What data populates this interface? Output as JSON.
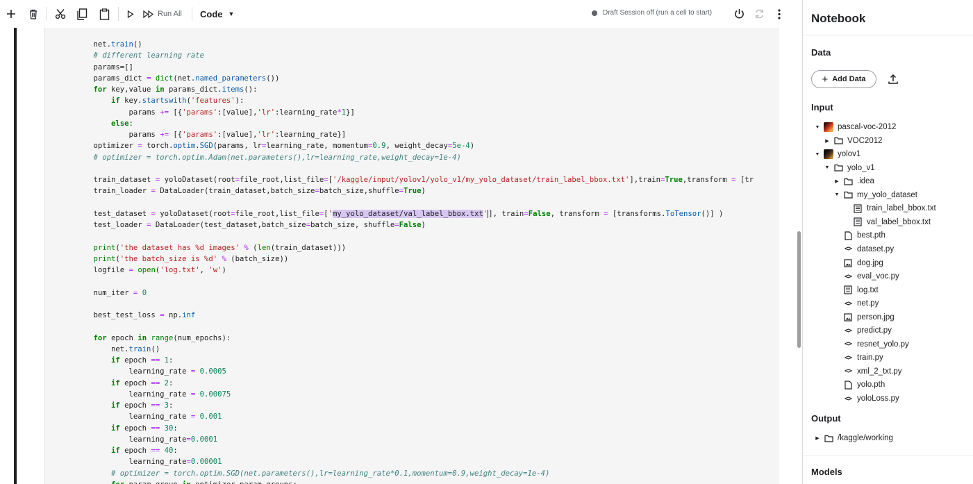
{
  "toolbar": {
    "run_all_label": "Run All",
    "cell_type": "Code",
    "session_status": "Draft Session off (run a cell to start)"
  },
  "code_lines": [
    [
      [
        "",
        "    net."
      ],
      [
        "f",
        "train"
      ],
      [
        "",
        "()"
      ]
    ],
    [
      [
        "c",
        "    # different learning rate"
      ]
    ],
    [
      [
        "",
        "    params=[]"
      ]
    ],
    [
      [
        "",
        "    params_dict "
      ],
      [
        "o",
        "="
      ],
      [
        "",
        ""
      ],
      [
        "b",
        " dict"
      ],
      [
        "",
        "(net."
      ],
      [
        "f",
        "named_parameters"
      ],
      [
        "",
        "())"
      ]
    ],
    [
      [
        "k",
        "    for"
      ],
      [
        "",
        " key,value "
      ],
      [
        "k",
        "in"
      ],
      [
        "",
        " params_dict."
      ],
      [
        "f",
        "items"
      ],
      [
        "",
        "():"
      ]
    ],
    [
      [
        "k",
        "        if"
      ],
      [
        "",
        " key."
      ],
      [
        "f",
        "startswith"
      ],
      [
        "",
        "("
      ],
      [
        "s",
        "'features'"
      ],
      [
        "",
        "):"
      ]
    ],
    [
      [
        "",
        "            params "
      ],
      [
        "o",
        "+="
      ],
      [
        "",
        " [{"
      ],
      [
        "s",
        "'params'"
      ],
      [
        "",
        ":[value],"
      ],
      [
        "s",
        "'lr'"
      ],
      [
        "",
        ":learning_rate"
      ],
      [
        "o",
        "*"
      ],
      [
        "n",
        "1"
      ],
      [
        "",
        "}]"
      ]
    ],
    [
      [
        "k",
        "        else"
      ],
      [
        "",
        ":"
      ]
    ],
    [
      [
        "",
        "            params "
      ],
      [
        "o",
        "+="
      ],
      [
        "",
        " [{"
      ],
      [
        "s",
        "'params'"
      ],
      [
        "",
        ":[value],"
      ],
      [
        "s",
        "'lr'"
      ],
      [
        "",
        ":learning_rate}]"
      ]
    ],
    [
      [
        "",
        "    optimizer "
      ],
      [
        "o",
        "="
      ],
      [
        "",
        " torch."
      ],
      [
        "f",
        "optim"
      ],
      [
        "",
        "."
      ],
      [
        "f",
        "SGD"
      ],
      [
        "",
        "(params, lr"
      ],
      [
        "o",
        "="
      ],
      [
        "",
        "learning_rate, momentum"
      ],
      [
        "o",
        "="
      ],
      [
        "n",
        "0.9"
      ],
      [
        "",
        ", weight_decay"
      ],
      [
        "o",
        "="
      ],
      [
        "n",
        "5e-4"
      ],
      [
        "",
        ")"
      ]
    ],
    [
      [
        "c",
        "    # optimizer = torch.optim.Adam(net.parameters(),lr=learning_rate,weight_decay=1e-4)"
      ]
    ],
    [
      [
        "",
        ""
      ]
    ],
    [
      [
        "",
        "    train_dataset "
      ],
      [
        "o",
        "="
      ],
      [
        "",
        " yoloDataset(root"
      ],
      [
        "o",
        "="
      ],
      [
        "",
        "file_root,list_file"
      ],
      [
        "o",
        "="
      ],
      [
        "",
        "["
      ],
      [
        "s",
        "'/kaggle/input/yolov1/yolo_v1/my_yolo_dataset/train_label_bbox.txt'"
      ],
      [
        "",
        "],train"
      ],
      [
        "o",
        "="
      ],
      [
        "k",
        "True"
      ],
      [
        "",
        ",transform "
      ],
      [
        "o",
        "="
      ],
      [
        "",
        " [tr"
      ]
    ],
    [
      [
        "",
        "    train_loader "
      ],
      [
        "o",
        "="
      ],
      [
        "",
        " DataLoader(train_dataset,batch_size"
      ],
      [
        "o",
        "="
      ],
      [
        "",
        "batch_size,shuffle"
      ],
      [
        "o",
        "="
      ],
      [
        "k",
        "True"
      ],
      [
        "",
        ")"
      ]
    ],
    [
      [
        "",
        ""
      ]
    ],
    [
      [
        "",
        "    test_dataset "
      ],
      [
        "o",
        "="
      ],
      [
        "",
        " yoloDataset(root"
      ],
      [
        "o",
        "="
      ],
      [
        "",
        "file_root,list_file"
      ],
      [
        "o",
        "="
      ],
      [
        "",
        "["
      ],
      [
        "s",
        "'"
      ],
      [
        "hl",
        "my_yolo_dataset/val_label_bbox.txt"
      ],
      [
        "s",
        "'"
      ],
      [
        "",
        ""
      ],
      [
        "cur",
        ""
      ],
      [
        "",
        ""
      ],
      [
        "",
        "], train"
      ],
      [
        "o",
        "="
      ],
      [
        "k",
        "False"
      ],
      [
        "",
        ", transform "
      ],
      [
        "o",
        "="
      ],
      [
        "",
        " [transforms."
      ],
      [
        "f",
        "ToTensor"
      ],
      [
        "",
        "()] )"
      ]
    ],
    [
      [
        "",
        "    test_loader "
      ],
      [
        "o",
        "="
      ],
      [
        "",
        " DataLoader(test_dataset,batch_size"
      ],
      [
        "o",
        "="
      ],
      [
        "",
        "batch_size, shuffle"
      ],
      [
        "o",
        "="
      ],
      [
        "k",
        "False"
      ],
      [
        "",
        ")"
      ]
    ],
    [
      [
        "",
        ""
      ]
    ],
    [
      [
        "b",
        "    print"
      ],
      [
        "",
        "("
      ],
      [
        "s",
        "'the dataset has %d images'"
      ],
      [
        "",
        " "
      ],
      [
        "o",
        "%"
      ],
      [
        "",
        " ("
      ],
      [
        "b",
        "len"
      ],
      [
        "",
        "(train_dataset)))"
      ]
    ],
    [
      [
        "b",
        "    print"
      ],
      [
        "",
        "("
      ],
      [
        "s",
        "'the batch_size is %d'"
      ],
      [
        "",
        " "
      ],
      [
        "o",
        "%"
      ],
      [
        "",
        " (batch_size))"
      ]
    ],
    [
      [
        "",
        "    logfile "
      ],
      [
        "o",
        "="
      ],
      [
        "b",
        " open"
      ],
      [
        "",
        "("
      ],
      [
        "s",
        "'log.txt'"
      ],
      [
        "",
        ", "
      ],
      [
        "s",
        "'w'"
      ],
      [
        "",
        ")"
      ]
    ],
    [
      [
        "",
        ""
      ]
    ],
    [
      [
        "",
        "    num_iter "
      ],
      [
        "o",
        "="
      ],
      [
        "n",
        " 0"
      ]
    ],
    [
      [
        "",
        ""
      ]
    ],
    [
      [
        "",
        "    best_test_loss "
      ],
      [
        "o",
        "="
      ],
      [
        "",
        " np."
      ],
      [
        "f",
        "inf"
      ]
    ],
    [
      [
        "",
        ""
      ]
    ],
    [
      [
        "k",
        "    for"
      ],
      [
        "",
        " epoch "
      ],
      [
        "k",
        "in"
      ],
      [
        "b",
        " range"
      ],
      [
        "",
        "(num_epochs):"
      ]
    ],
    [
      [
        "",
        "        net."
      ],
      [
        "f",
        "train"
      ],
      [
        "",
        "()"
      ]
    ],
    [
      [
        "k",
        "        if"
      ],
      [
        "",
        " epoch "
      ],
      [
        "o",
        "=="
      ],
      [
        "n",
        " 1"
      ],
      [
        "",
        ":"
      ]
    ],
    [
      [
        "",
        "            learning_rate "
      ],
      [
        "o",
        "="
      ],
      [
        "n",
        " 0.0005"
      ]
    ],
    [
      [
        "k",
        "        if"
      ],
      [
        "",
        " epoch "
      ],
      [
        "o",
        "=="
      ],
      [
        "n",
        " 2"
      ],
      [
        "",
        ":"
      ]
    ],
    [
      [
        "",
        "            learning_rate "
      ],
      [
        "o",
        "="
      ],
      [
        "n",
        " 0.00075"
      ]
    ],
    [
      [
        "k",
        "        if"
      ],
      [
        "",
        " epoch "
      ],
      [
        "o",
        "=="
      ],
      [
        "n",
        " 3"
      ],
      [
        "",
        ":"
      ]
    ],
    [
      [
        "",
        "            learning_rate "
      ],
      [
        "o",
        "="
      ],
      [
        "n",
        " 0.001"
      ]
    ],
    [
      [
        "k",
        "        if"
      ],
      [
        "",
        " epoch "
      ],
      [
        "o",
        "=="
      ],
      [
        "n",
        " 30"
      ],
      [
        "",
        ":"
      ]
    ],
    [
      [
        "",
        "            learning_rate"
      ],
      [
        "o",
        "="
      ],
      [
        "n",
        "0.0001"
      ]
    ],
    [
      [
        "k",
        "        if"
      ],
      [
        "",
        " epoch "
      ],
      [
        "o",
        "=="
      ],
      [
        "n",
        " 40"
      ],
      [
        "",
        ":"
      ]
    ],
    [
      [
        "",
        "            learning_rate"
      ],
      [
        "o",
        "="
      ],
      [
        "n",
        "0.00001"
      ]
    ],
    [
      [
        "c",
        "        # optimizer = torch.optim.SGD(net.parameters(),lr=learning_rate*0.1,momentum=0.9,weight_decay=1e-4)"
      ]
    ],
    [
      [
        "k",
        "        for"
      ],
      [
        "",
        " param_group "
      ],
      [
        "k",
        "in"
      ],
      [
        "",
        " optimizer.param_groups:"
      ]
    ]
  ],
  "sidebar": {
    "title": "Notebook",
    "data_section": "Data",
    "add_data_label": "Add Data",
    "input_section": "Input",
    "output_section": "Output",
    "models_section": "Models",
    "tree": [
      {
        "label": "pascal-voc-2012",
        "tri": "open",
        "icon": "dataset-red"
      },
      {
        "label": "VOC2012",
        "tri": "closed",
        "icon": "folder"
      },
      {
        "label": "yolov1",
        "tri": "open",
        "icon": "dataset-dark"
      },
      {
        "label": "yolo_v1",
        "tri": "open",
        "icon": "folder"
      },
      {
        "label": ".idea",
        "tri": "closed",
        "icon": "folder"
      },
      {
        "label": "my_yolo_dataset",
        "tri": "open",
        "icon": "folder"
      },
      {
        "label": "train_label_bbox.txt",
        "tri": "none",
        "icon": "text"
      },
      {
        "label": "val_label_bbox.txt",
        "tri": "none",
        "icon": "text"
      },
      {
        "label": "best.pth",
        "tri": "none",
        "icon": "file"
      },
      {
        "label": "dataset.py",
        "tri": "none",
        "icon": "code"
      },
      {
        "label": "dog.jpg",
        "tri": "none",
        "icon": "image"
      },
      {
        "label": "eval_voc.py",
        "tri": "none",
        "icon": "code"
      },
      {
        "label": "log.txt",
        "tri": "none",
        "icon": "text"
      },
      {
        "label": "net.py",
        "tri": "none",
        "icon": "code"
      },
      {
        "label": "person.jpg",
        "tri": "none",
        "icon": "image"
      },
      {
        "label": "predict.py",
        "tri": "none",
        "icon": "code"
      },
      {
        "label": "resnet_yolo.py",
        "tri": "none",
        "icon": "code"
      },
      {
        "label": "train.py",
        "tri": "none",
        "icon": "code"
      },
      {
        "label": "xml_2_txt.py",
        "tri": "none",
        "icon": "code"
      },
      {
        "label": "yolo.pth",
        "tri": "none",
        "icon": "file"
      },
      {
        "label": "yoloLoss.py",
        "tri": "none",
        "icon": "code"
      }
    ],
    "output_tree": [
      {
        "label": "/kaggle/working",
        "tri": "closed",
        "icon": "folder"
      }
    ]
  }
}
